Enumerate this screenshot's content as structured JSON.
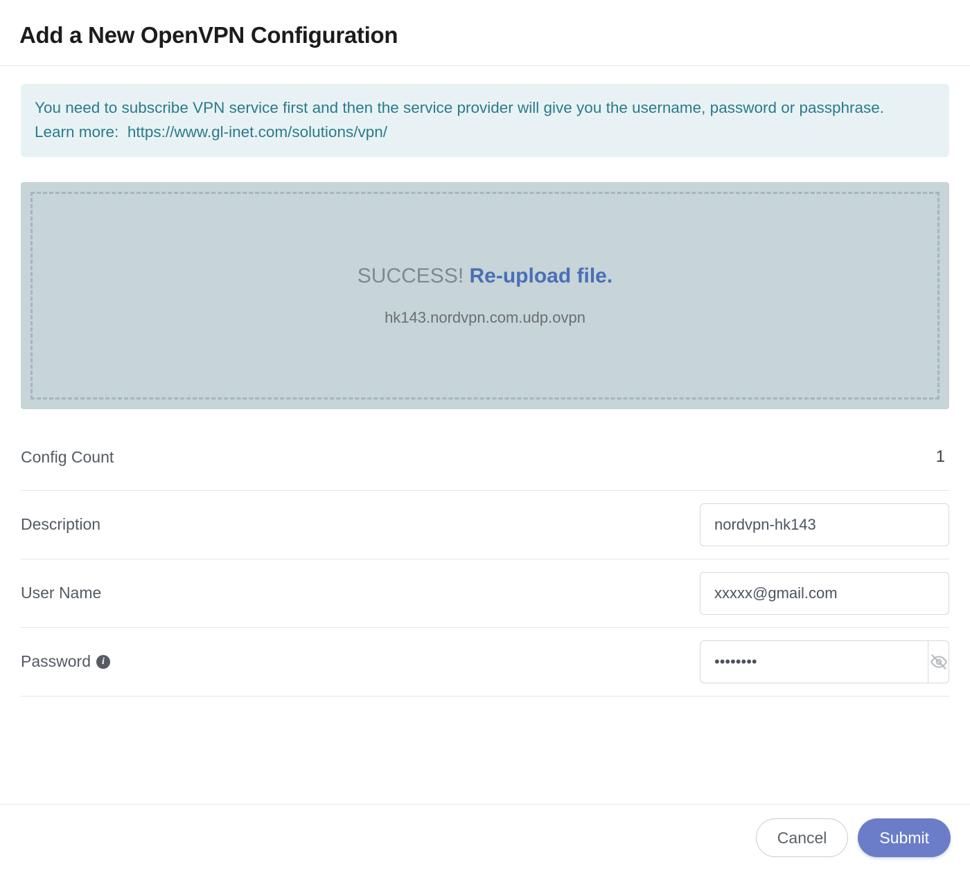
{
  "header": {
    "title": "Add a New OpenVPN Configuration"
  },
  "notice": {
    "text": "You need to subscribe VPN service first and then the service provider will give you the username, password or passphrase.",
    "learn_more_label": "Learn more:",
    "learn_more_link_text": "https://www.gl-inet.com/solutions/vpn/"
  },
  "upload": {
    "success_label": "SUCCESS!",
    "reupload_label": "Re-upload file.",
    "filename": "hk143.nordvpn.com.udp.ovpn"
  },
  "fields": {
    "config_count": {
      "label": "Config Count",
      "value": "1"
    },
    "description": {
      "label": "Description",
      "value": "nordvpn-hk143"
    },
    "username": {
      "label": "User Name",
      "value": "xxxxx@gmail.com"
    },
    "password": {
      "label": "Password",
      "value": "••••••••"
    }
  },
  "footer": {
    "cancel_label": "Cancel",
    "submit_label": "Submit"
  }
}
